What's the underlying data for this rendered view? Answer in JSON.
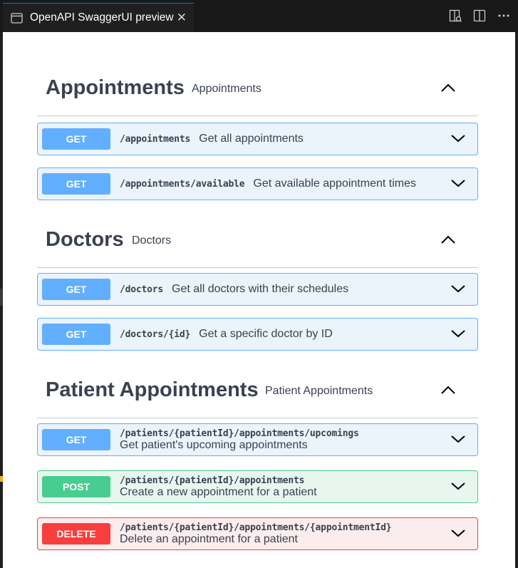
{
  "tab": {
    "title": "OpenAPI SwaggerUI preview",
    "close_glyph": "✕"
  },
  "sections": [
    {
      "title": "Appointments",
      "subtitle": "Appointments",
      "operations": [
        {
          "method": "GET",
          "path": "/appointments",
          "summary": "Get all appointments"
        },
        {
          "method": "GET",
          "path": "/appointments/available",
          "summary": "Get available appointment times"
        }
      ]
    },
    {
      "title": "Doctors",
      "subtitle": "Doctors",
      "operations": [
        {
          "method": "GET",
          "path": "/doctors",
          "summary": "Get all doctors with their schedules"
        },
        {
          "method": "GET",
          "path": "/doctors/{id}",
          "summary": "Get a specific doctor by ID"
        }
      ]
    },
    {
      "title": "Patient Appointments",
      "subtitle": "Patient Appointments",
      "operations": [
        {
          "method": "GET",
          "path": "/patients/{patientId}/appointments/upcomings",
          "summary": "Get patient's upcoming appointments"
        },
        {
          "method": "POST",
          "path": "/patients/{patientId}/appointments",
          "summary": "Create a new appointment for a patient"
        },
        {
          "method": "DELETE",
          "path": "/patients/{patientId}/appointments/{appointmentId}",
          "summary": "Delete an appointment for a patient"
        }
      ]
    }
  ],
  "colors": {
    "get": "#61affe",
    "post": "#49cc90",
    "delete": "#f93e3e",
    "text": "#3b4151"
  },
  "icons": {
    "tab": "preview-icon",
    "actions": [
      "open-preview-icon",
      "split-editor-icon",
      "more-actions-icon"
    ],
    "collapse": "chevron-up-icon",
    "expand": "chevron-down-icon"
  }
}
